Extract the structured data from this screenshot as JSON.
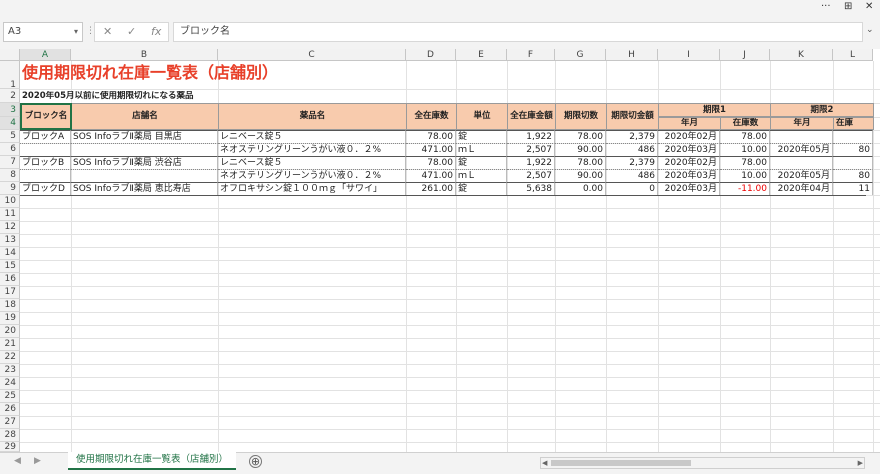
{
  "window": {
    "more_label": "···",
    "restore_label": "⊞",
    "close_label": "✕"
  },
  "formula_bar": {
    "name_box": "A3",
    "name_box_arrow": "▾",
    "cancel": "✕",
    "enter": "✓",
    "fx": "fx",
    "content": "ブロック名",
    "expand": "⌄"
  },
  "columns": [
    "A",
    "B",
    "C",
    "D",
    "E",
    "F",
    "G",
    "H",
    "I",
    "J",
    "K",
    "L"
  ],
  "rows": [
    "1",
    "2",
    "3",
    "4",
    "5",
    "6",
    "7",
    "8",
    "9",
    "10",
    "11",
    "12",
    "13",
    "14",
    "15",
    "16",
    "17",
    "18",
    "19",
    "20",
    "21",
    "22",
    "23",
    "24",
    "25",
    "26",
    "27",
    "28",
    "29"
  ],
  "sheet": {
    "title": "使用期限切れ在庫一覧表（店舗別）",
    "subtitle": "2020年05月以前に使用期限切れになる薬品",
    "headers": {
      "block": "ブロック名",
      "store": "店舗名",
      "drug": "薬品名",
      "total_stock": "全在庫数",
      "unit": "単位",
      "total_amount": "全在庫金額",
      "expired_qty": "期限切数",
      "expired_amount": "期限切金額",
      "period1": "期限1",
      "period2": "期限2",
      "ym": "年月",
      "stock": "在庫数",
      "ym2": "年月",
      "stock2": "在庫"
    },
    "data": [
      {
        "block": "ブロックA",
        "store": "SOS InfoラブⅡ薬局 目黒店",
        "drug": "レニベース錠５",
        "total": "78.00",
        "unit": "錠",
        "amount": "1,922",
        "exp_qty": "78.00",
        "exp_amt": "2,379",
        "p1_ym": "2020年02月",
        "p1_stock": "78.00",
        "p2_ym": "",
        "p2_stock": ""
      },
      {
        "block": "",
        "store": "",
        "drug": "ネオステリングリーンうがい液０．２%",
        "total": "471.00",
        "unit": "ｍＬ",
        "amount": "2,507",
        "exp_qty": "90.00",
        "exp_amt": "486",
        "p1_ym": "2020年03月",
        "p1_stock": "10.00",
        "p2_ym": "2020年05月",
        "p2_stock": "80"
      },
      {
        "block": "ブロックB",
        "store": "SOS InfoラブⅡ薬局 渋谷店",
        "drug": "レニベース錠５",
        "total": "78.00",
        "unit": "錠",
        "amount": "1,922",
        "exp_qty": "78.00",
        "exp_amt": "2,379",
        "p1_ym": "2020年02月",
        "p1_stock": "78.00",
        "p2_ym": "",
        "p2_stock": ""
      },
      {
        "block": "",
        "store": "",
        "drug": "ネオステリングリーンうがい液０．２%",
        "total": "471.00",
        "unit": "ｍＬ",
        "amount": "2,507",
        "exp_qty": "90.00",
        "exp_amt": "486",
        "p1_ym": "2020年03月",
        "p1_stock": "10.00",
        "p2_ym": "2020年05月",
        "p2_stock": "80"
      },
      {
        "block": "ブロックD",
        "store": "SOS InfoラブⅡ薬局 恵比寿店",
        "drug": "オフロキサシン錠１００ｍｇ「サワイ」",
        "total": "261.00",
        "unit": "錠",
        "amount": "5,638",
        "exp_qty": "0.00",
        "exp_amt": "0",
        "p1_ym": "2020年03月",
        "p1_stock": "-11.00",
        "p2_ym": "2020年04月",
        "p2_stock": "11"
      }
    ]
  },
  "sheet_tabs": {
    "active": "使用期限切れ在庫一覧表（店舗別）",
    "add": "⊕",
    "prev": "◀",
    "next": "▶"
  },
  "colors": {
    "title": "#e8402a",
    "header_fill": "#f8cbad",
    "accent": "#217346",
    "negative": "#e00000"
  }
}
